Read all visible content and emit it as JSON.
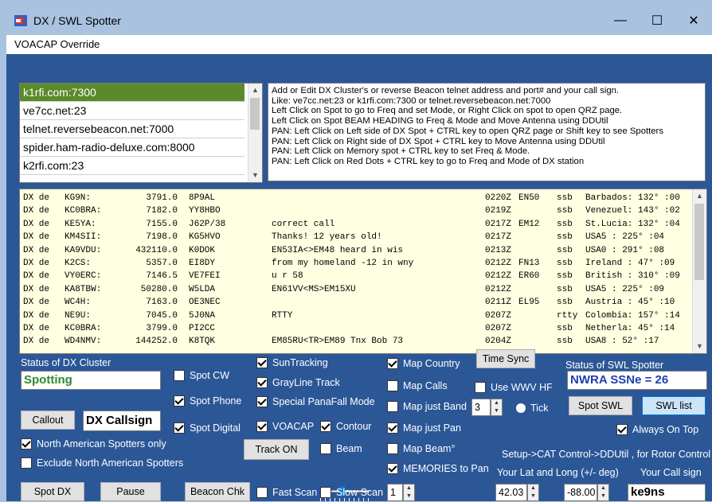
{
  "window": {
    "title": "DX / SWL Spotter",
    "icon": "flag-icon",
    "controls": {
      "minimize": "—",
      "maximize": "☐",
      "close": "✕"
    }
  },
  "menu": {
    "items": [
      "VOACAP Override"
    ]
  },
  "clusters": {
    "items": [
      "k1rfi.com:7300",
      "ve7cc.net:23",
      "telnet.reversebeacon.net:7000",
      "spider.ham-radio-deluxe.com:8000",
      "k2rfi.com:23"
    ],
    "selected_index": 0
  },
  "help_lines": [
    "Add or Edit DX Cluster's or reverse Beacon telnet address and port# and your call sign.",
    "Like: ve7cc.net:23 or k1rfi.com:7300 or telnet.reversebeacon.net:7000",
    "Left Click on Spot to go to Freq and set Mode, or Right Click on spot to open QRZ page.",
    "Left Click on Spot BEAM HEADING to Freq & Mode and Move Antenna using DDUtil",
    "PAN: Left Click on Left side of DX Spot + CTRL key to open QRZ page or Shift key to see Spotters",
    "PAN: Left Click on Right side of DX Spot + CTRL key to Move Antenna using DDUtil",
    "PAN: Left Click on Memory spot + CTRL key  to set Freq & Mode.",
    "PAN: Left Click on Red Dots  + CTRL key to go to Freq and Mode of DX station"
  ],
  "spots": [
    {
      "dx": "DX de",
      "call": "KG9N:",
      "freq": "3791.0",
      "dxcall": "8P9AL",
      "comment": "",
      "time": "0220Z",
      "grid": "EN50",
      "mode": "ssb",
      "country": "Barbados: 132° :00"
    },
    {
      "dx": "DX de",
      "call": "KC0BRA:",
      "freq": "7182.0",
      "dxcall": "YY8HBO",
      "comment": "",
      "time": "0219Z",
      "grid": "",
      "mode": "ssb",
      "country": "Venezuel: 143° :02"
    },
    {
      "dx": "DX de",
      "call": "KE5YA:",
      "freq": "7155.0",
      "dxcall": "J62P/38",
      "comment": "correct call",
      "time": "0217Z",
      "grid": "EM12",
      "mode": "ssb",
      "country": "St.Lucia: 132° :04"
    },
    {
      "dx": "DX de",
      "call": "KM4SII:",
      "freq": "7198.0",
      "dxcall": "KG5HVO",
      "comment": "Thanks! 12 years old!",
      "time": "0217Z",
      "grid": "",
      "mode": "ssb",
      "country": "USA5    : 225° :04"
    },
    {
      "dx": "DX de",
      "call": "KA9VDU:",
      "freq": "432110.0",
      "dxcall": "K0DOK",
      "comment": "EN53IA<>EM48 heard in wis",
      "time": "0213Z",
      "grid": "",
      "mode": "ssb",
      "country": "USA0    : 291° :08"
    },
    {
      "dx": "DX de",
      "call": "K2CS:",
      "freq": "5357.0",
      "dxcall": "EI8DY",
      "comment": "from my homeland -12 in wny",
      "time": "0212Z",
      "grid": "FN13",
      "mode": "ssb",
      "country": "Ireland :  47° :09"
    },
    {
      "dx": "DX de",
      "call": "VY0ERC:",
      "freq": "7146.5",
      "dxcall": "VE7FEI",
      "comment": "u r 58",
      "time": "0212Z",
      "grid": "ER60",
      "mode": "ssb",
      "country": "British : 310° :09"
    },
    {
      "dx": "DX de",
      "call": "KA8TBW:",
      "freq": "50280.0",
      "dxcall": "W5LDA",
      "comment": "EN61VV<MS>EM15XU",
      "time": "0212Z",
      "grid": "",
      "mode": "ssb",
      "country": "USA5    : 225° :09"
    },
    {
      "dx": "DX de",
      "call": "WC4H:",
      "freq": "7163.0",
      "dxcall": "OE3NEC",
      "comment": "",
      "time": "0211Z",
      "grid": "EL95",
      "mode": "ssb",
      "country": "Austria :  45° :10"
    },
    {
      "dx": "DX de",
      "call": "NE9U:",
      "freq": "7045.0",
      "dxcall": "5J0NA",
      "comment": "RTTY",
      "time": "0207Z",
      "grid": "",
      "mode": "rtty",
      "country": "Colombia: 157° :14"
    },
    {
      "dx": "DX de",
      "call": "KC0BRA:",
      "freq": "3799.0",
      "dxcall": "PI2CC",
      "comment": "",
      "time": "0207Z",
      "grid": "",
      "mode": "ssb",
      "country": "Netherla:  45° :14"
    },
    {
      "dx": "DX de",
      "call": "WD4NMV:",
      "freq": "144252.0",
      "dxcall": "K8TQK",
      "comment": "EM85RU<TR>EM89 Tnx Bob 73",
      "time": "0204Z",
      "grid": "",
      "mode": "ssb",
      "country": "USA8    :  52° :17"
    }
  ],
  "cluster_status": {
    "label": "Status of DX Cluster",
    "value": "Spotting"
  },
  "swl_status": {
    "label": "Status of SWL Spotter",
    "value": "NWRA SSNe = 26"
  },
  "buttons": {
    "callout": "Callout",
    "dx_callsign": "DX Callsign",
    "spot_dx": "Spot DX",
    "pause": "Pause",
    "beacon_chk": "Beacon Chk",
    "track_on": "Track ON",
    "time_sync": "Time Sync",
    "spot_swl": "Spot SWL",
    "swl_list": "SWL list"
  },
  "checkboxes": {
    "spot_cw": {
      "label": "Spot CW",
      "checked": false
    },
    "spot_phone": {
      "label": "Spot Phone",
      "checked": true
    },
    "spot_digital": {
      "label": "Spot Digital",
      "checked": true
    },
    "na_only": {
      "label": "North American Spotters only",
      "checked": true
    },
    "exclude_na": {
      "label": "Exclude North American Spotters",
      "checked": false
    },
    "suntracking": {
      "label": "SunTracking",
      "checked": true
    },
    "grayline": {
      "label": "GrayLine Track",
      "checked": true
    },
    "special_panafall": {
      "label": "Special PanaFall Mode",
      "checked": true
    },
    "voacap": {
      "label": "VOACAP",
      "checked": true
    },
    "contour": {
      "label": "Contour",
      "checked": true
    },
    "beam": {
      "label": "Beam",
      "checked": false
    },
    "fast_scan": {
      "label": "Fast Scan",
      "checked": false
    },
    "slow_scan": {
      "label": "Slow Scan",
      "checked": false
    },
    "map_country": {
      "label": "Map Country",
      "checked": true
    },
    "map_calls": {
      "label": "Map Calls",
      "checked": false
    },
    "map_just_band": {
      "label": "Map just Band",
      "checked": false
    },
    "map_just_pan": {
      "label": "Map just Pan",
      "checked": true
    },
    "map_beam": {
      "label": "Map Beam°",
      "checked": false
    },
    "memories": {
      "label": "MEMORIES to Pan",
      "checked": true
    },
    "use_wwv": {
      "label": "Use WWV HF",
      "checked": false
    },
    "always_on_top": {
      "label": "Always On Top",
      "checked": true
    }
  },
  "tick": {
    "label": "Tick"
  },
  "band_value": "3",
  "scan_value": "1",
  "setup_text": "Setup->CAT Control->DDUtil , for Rotor Control",
  "latlong_label": "Your Lat and Long (+/- deg)",
  "callsign_label": "Your Call sign",
  "lat": "42.03",
  "lon": "-88.00",
  "callsign": "ke9ns",
  "colors": {
    "panel": "#2b5797",
    "selected": "#5a8a2a",
    "spot_bg": "#ffffe1",
    "status_green": "#2e8b2e",
    "swl_blue": "#1e3fb0"
  }
}
